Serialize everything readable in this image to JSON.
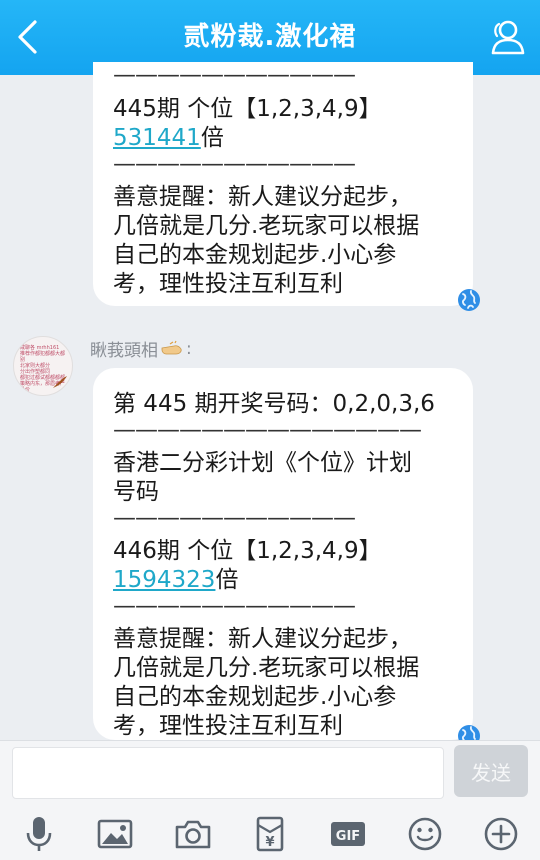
{
  "header": {
    "title": "贰粉裁.激化裙"
  },
  "messages": [
    {
      "dash_top": "———————————",
      "period_line": "445期 个位【1,2,3,4,9】",
      "multiplier_value": "531441",
      "multiplier_unit": "倍",
      "dash_bottom": "———————————",
      "reminder": [
        "善意提醒：新人建议分起步，",
        "几倍就是几分.老玩家可以根据",
        "自己的本金规划起步.小心参",
        "考，理性投注互利互利"
      ]
    },
    {
      "sender": "瞅莪頭相",
      "draw_line": "第 445 期开奖号码：0,2,0,3,6",
      "dash_1": "——————————————",
      "plan_line_1": "香港二分彩计划《个位》计划",
      "plan_line_2": "号码",
      "dash_2": "———————————",
      "period_line": "446期 个位【1,2,3,4,9】",
      "multiplier_value": "1594323",
      "multiplier_unit": "倍",
      "dash_3": "———————————",
      "reminder": [
        "善意提醒：新人建议分起步，",
        "几倍就是几分.老玩家可以根据",
        "自己的本金规划起步.小心参",
        "考，理性投注互利互利"
      ]
    }
  ],
  "avatar_text": [
    "咸聊各 mrhh161",
    "推荐作都犯都都大都别",
    "北家则大都分",
    "分出作塑都同",
    "都犯过都试都都都都",
    "策略内东，那眉者严品价"
  ],
  "input": {
    "placeholder": "",
    "send_label": "发送"
  },
  "toolbar": {
    "icons": [
      "microphone-icon",
      "image-icon",
      "camera-icon",
      "red-packet-icon",
      "gif-icon",
      "emoji-icon",
      "plus-icon"
    ],
    "gif_label": "GIF"
  },
  "colors": {
    "header": "#1aa9f3",
    "link": "#1fa8c9",
    "background": "#ebeef2"
  }
}
